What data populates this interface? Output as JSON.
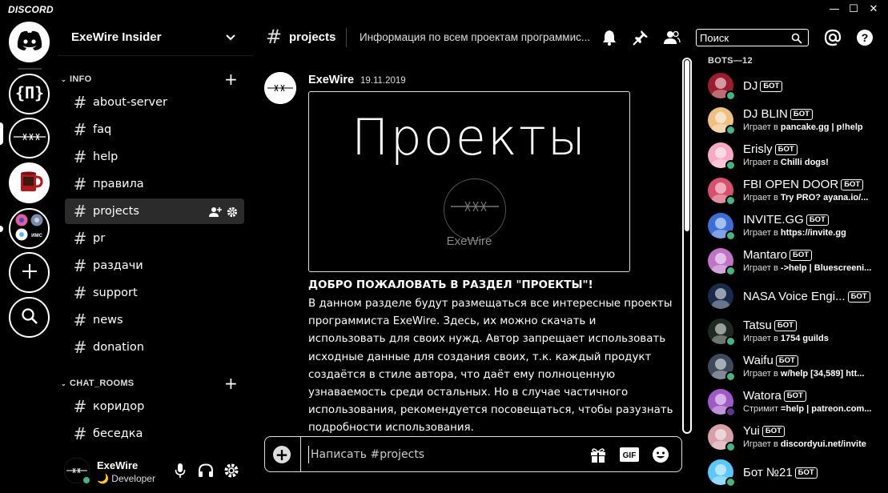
{
  "app": {
    "title": "DISCORD"
  },
  "window_controls": {
    "minimize": "—",
    "maximize": "☐",
    "close": "✕"
  },
  "guild": {
    "name": "ExeWire Insider"
  },
  "categories": [
    {
      "label": "INFO",
      "channels": [
        "about-server",
        "faq",
        "help",
        "правила",
        "projects",
        "pr",
        "раздачи",
        "support",
        "news",
        "donation"
      ]
    },
    {
      "label": "CHAT_ROOMS",
      "channels": [
        "коридор",
        "беседка"
      ]
    }
  ],
  "active_channel": "projects",
  "user": {
    "name": "ExeWire",
    "status": "🌙 Developer"
  },
  "channel_header": {
    "hash": "#",
    "name": "projects",
    "topic": "Информация по всем проектам программис..."
  },
  "search": {
    "placeholder": "Поиск"
  },
  "message": {
    "author": "ExeWire",
    "timestamp": "19.11.2019",
    "embed_title": "Проекты",
    "embed_brand": "ExeWire",
    "heading": "ДОБРО ПОЖАЛОВАТЬ В РАЗДЕЛ \"ПРОЕКТЫ\"!",
    "body": "В данном разделе будут размещаться все интересные проекты программиста ExeWire. Здесь, их можно скачать и использовать для своих нужд. Автор запрещает  использовать исходные данные для создания своих, т.к. каждый продукт создаётся в стиле автора, что даёт ему полноценную узнаваемость среди остальных. Но в случае частичного использования, рекомендуется посовещаться, чтобы разузнать подробности использования."
  },
  "composer": {
    "placeholder": "Написать #projects",
    "gif_label": "GIF"
  },
  "member_group": "BOTS—12",
  "bot_tag": "БОТ",
  "members": [
    {
      "name": "DJ",
      "activity_prefix": "",
      "activity": "",
      "status": "online",
      "color": "#9b1d2e",
      "icon": "vinyl-avatar"
    },
    {
      "name": "DJ BLIN",
      "activity_prefix": "Играет в ",
      "activity": "pancake.gg | p!help",
      "status": "online",
      "color": "#f0c080",
      "icon": "pancake-avatar"
    },
    {
      "name": "Erisly",
      "activity_prefix": "Играет в ",
      "activity": "Chilli dogs!",
      "status": "online",
      "color": "#f7a8c4",
      "icon": "anime-girl-avatar"
    },
    {
      "name": "FBI OPEN DOOR",
      "activity_prefix": "Играет в ",
      "activity": "Try PRO? ayana.io/...",
      "status": "online",
      "color": "#d94f6e",
      "icon": "anime-girl-avatar"
    },
    {
      "name": "INVITE.GG",
      "activity_prefix": "Играет в ",
      "activity": "https://invite.gg",
      "status": "online",
      "color": "#3b6fd8",
      "icon": "invite-logo-avatar"
    },
    {
      "name": "Mantaro",
      "activity_prefix": "Играет в ",
      "activity": "->help | Bluescreeni...",
      "status": "online",
      "color": "#c074c8",
      "icon": "anime-girl-avatar"
    },
    {
      "name": "NASA Voice Engi...",
      "activity_prefix": "",
      "activity": "",
      "status": "none",
      "color": "#1b2a4a",
      "icon": "nasa-avatar"
    },
    {
      "name": "Tatsu",
      "activity_prefix": "Играет в ",
      "activity": "1754 guilds",
      "status": "online",
      "color": "#1f2b22",
      "icon": "tatsu-avatar"
    },
    {
      "name": "Waifu",
      "activity_prefix": "Играет в ",
      "activity": "w/help [34,589] htt...",
      "status": "online",
      "color": "#3d4a5c",
      "icon": "anime-girl-avatar"
    },
    {
      "name": "Watora",
      "activity_prefix": "Стримит ",
      "activity": "=help | patreon.com...",
      "status": "streaming",
      "color": "#a05ac8",
      "icon": "anime-girl-avatar"
    },
    {
      "name": "Yui",
      "activity_prefix": "Играет в ",
      "activity": "discordyui.net/invite",
      "status": "online",
      "color": "#d8a0a8",
      "icon": "anime-girl-avatar"
    },
    {
      "name": "Бот №21",
      "activity_prefix": "",
      "activity": "",
      "status": "online",
      "color": "#5ac8fa",
      "icon": "blob-avatar"
    }
  ],
  "colors": {
    "online": "#43b581",
    "streaming": "#593695",
    "background": "#000000",
    "foreground": "#ffffff"
  }
}
